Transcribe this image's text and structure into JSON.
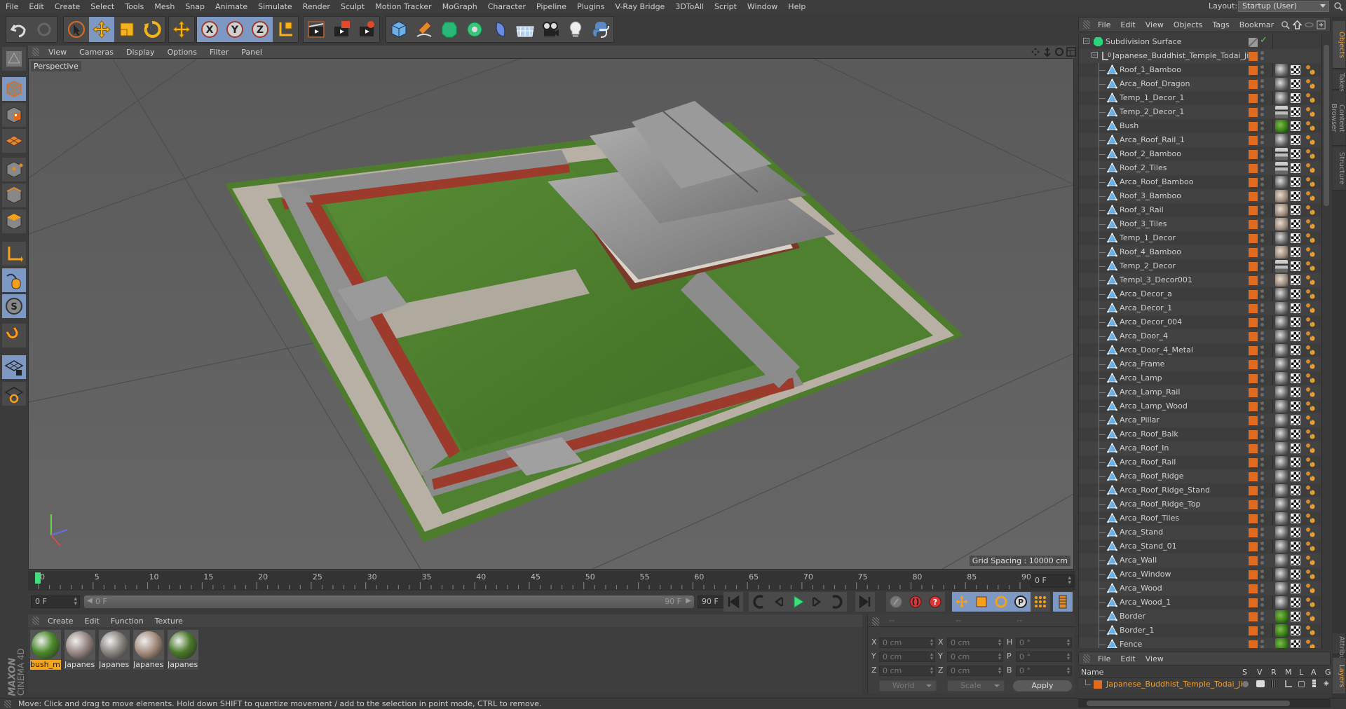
{
  "menubar": {
    "items": [
      "File",
      "Edit",
      "Create",
      "Select",
      "Tools",
      "Mesh",
      "Snap",
      "Animate",
      "Simulate",
      "Render",
      "Sculpt",
      "Motion Tracker",
      "MoGraph",
      "Character",
      "Pipeline",
      "Plugins",
      "V-Ray Bridge",
      "3DToAll",
      "Script",
      "Window",
      "Help"
    ],
    "layout_label": "Layout:",
    "layout_value": "Startup (User)"
  },
  "toolbar": {
    "groups": [
      [
        "undo-icon",
        "redo-icon"
      ],
      [
        "live-selection-icon",
        "move-icon",
        "scale-icon",
        "rotate-icon"
      ],
      [
        "recent-tool-icon"
      ],
      [
        "x-axis-lock-icon",
        "y-axis-lock-icon",
        "z-axis-lock-icon",
        "coordinate-system-icon"
      ],
      [
        "render-view-icon",
        "render-picture-viewer-icon",
        "edit-render-settings-icon"
      ],
      [
        "cube-icon",
        "pen-spline-icon",
        "subdivision-surface-icon",
        "cloner-icon",
        "deformer-icon",
        "floor-icon",
        "camera-icon",
        "light-icon",
        "python-icon"
      ]
    ]
  },
  "lefttools": [
    "model-mode-icon",
    "object-mode-icon",
    "texture-mode-icon",
    "workplane-icon",
    "points-mode-icon",
    "edges-mode-icon",
    "polygons-mode-icon",
    "axis-mode-icon",
    "tweak-mode-icon",
    "solo-icon",
    "snap-magnet-icon",
    "lock-workplane-icon",
    "workplane-planar-icon"
  ],
  "viewport": {
    "menu": [
      "View",
      "Cameras",
      "Display",
      "Options",
      "Filter",
      "Panel"
    ],
    "camera_label": "Perspective",
    "grid_spacing": "Grid Spacing : 10000 cm",
    "colors": {
      "background": "#5c5c5c",
      "grass": "#4d7d2c",
      "roof": "#8a8a8a",
      "wall": "#9c3a2c",
      "path": "#b5aca0"
    }
  },
  "timeline": {
    "start": 0,
    "end": 90,
    "major_step": 5,
    "labels": [
      "0",
      "5",
      "10",
      "15",
      "20",
      "25",
      "30",
      "35",
      "40",
      "45",
      "50",
      "55",
      "60",
      "65",
      "70",
      "75",
      "80",
      "85",
      "90"
    ],
    "current_frame_field": "0 F",
    "range_start_field": "0 F",
    "range_slider_start": "0 F",
    "range_slider_end": "90 F",
    "range_end_field": "90 F",
    "current_frame": 0
  },
  "transport": [
    "go-to-start-icon",
    "previous-keyframe-icon",
    "previous-frame-icon",
    "play-icon",
    "next-frame-icon",
    "next-keyframe-icon",
    "go-to-end-icon",
    "motion-path-icon",
    "record-keyframe-icon",
    "autokey-icon",
    "key-position-icon",
    "key-scale-icon",
    "key-rotation-icon",
    "key-parameter-icon",
    "key-pla-icon",
    "timeline-icon"
  ],
  "materials": {
    "menu": [
      "Create",
      "Edit",
      "Function",
      "Texture"
    ],
    "items": [
      {
        "label": "bush_m",
        "selected": true,
        "color": "#4a8a2a"
      },
      {
        "label": "Japanes",
        "selected": false,
        "color": "#9a8a86"
      },
      {
        "label": "Japanes",
        "selected": false,
        "color": "#8a8680"
      },
      {
        "label": "Japanes",
        "selected": false,
        "color": "#a89080"
      },
      {
        "label": "Japanes",
        "selected": false,
        "color": "#4a7a2a"
      }
    ]
  },
  "coordinates": {
    "header": [
      "--",
      "--",
      "--"
    ],
    "position": {
      "X": "0 cm",
      "Y": "0 cm",
      "Z": "0 cm"
    },
    "size": {
      "X": "0 cm",
      "Y": "0 cm",
      "Z": "0 cm"
    },
    "rotation": {
      "H": "0 °",
      "P": "0 °",
      "B": "0 °"
    },
    "space_dropdown": "World",
    "mode_dropdown": "Scale",
    "apply_label": "Apply"
  },
  "status": "Move: Click and drag to move elements. Hold down SHIFT to quantize movement / add to the selection in point mode, CTRL to remove.",
  "brand": {
    "line1": "MAXON",
    "line2": "CINEMA 4D"
  },
  "objects": {
    "menu": [
      "File",
      "Edit",
      "View",
      "Objects",
      "Tags",
      "Bookmar"
    ],
    "root": "Subdivision Surface",
    "group": "Japanese_Buddhist_Temple_Todai_Ji",
    "children": [
      {
        "name": "Roof_1_Bamboo",
        "mat": "stone"
      },
      {
        "name": "Arca_Roof_Dragon",
        "mat": "stone"
      },
      {
        "name": "Temp_1_Decor_1",
        "mat": "stone"
      },
      {
        "name": "Temp_2_Decor_1",
        "mat": "stripe"
      },
      {
        "name": "Bush",
        "mat": "green"
      },
      {
        "name": "Arca_Roof_Rail_1",
        "mat": "stone"
      },
      {
        "name": "Roof_2_Bamboo",
        "mat": "stripe"
      },
      {
        "name": "Roof_2_Tiles",
        "mat": "stripe"
      },
      {
        "name": "Arca_Roof_Bamboo",
        "mat": "stone"
      },
      {
        "name": "Roof_3_Bamboo",
        "mat": "warm"
      },
      {
        "name": "Roof_3_Rail",
        "mat": "warm"
      },
      {
        "name": "Roof_3_Tiles",
        "mat": "warm"
      },
      {
        "name": "Temp_1_Decor",
        "mat": "stone"
      },
      {
        "name": "Roof_4_Bamboo",
        "mat": "warm"
      },
      {
        "name": "Temp_2_Decor",
        "mat": "stripe"
      },
      {
        "name": "Templ_3_Decor001",
        "mat": "warm"
      },
      {
        "name": "Arca_Decor_a",
        "mat": "stone"
      },
      {
        "name": "Arca_Decor_1",
        "mat": "stone"
      },
      {
        "name": "Arca_Decor_004",
        "mat": "stone"
      },
      {
        "name": "Arca_Door_4",
        "mat": "stone"
      },
      {
        "name": "Arca_Door_4_Metal",
        "mat": "stone"
      },
      {
        "name": "Arca_Frame",
        "mat": "stone"
      },
      {
        "name": "Arca_Lamp",
        "mat": "stone"
      },
      {
        "name": "Arca_Lamp_Rail",
        "mat": "stone"
      },
      {
        "name": "Arca_Lamp_Wood",
        "mat": "stone"
      },
      {
        "name": "Arca_Pillar",
        "mat": "stone"
      },
      {
        "name": "Arca_Roof_Balk",
        "mat": "stone"
      },
      {
        "name": "Arca_Roof_In",
        "mat": "stone"
      },
      {
        "name": "Arca_Roof_Rail",
        "mat": "stone"
      },
      {
        "name": "Arca_Roof_Ridge",
        "mat": "stone"
      },
      {
        "name": "Arca_Roof_Ridge_Stand",
        "mat": "stone"
      },
      {
        "name": "Arca_Roof_Ridge_Top",
        "mat": "stone"
      },
      {
        "name": "Arca_Roof_Tiles",
        "mat": "stone"
      },
      {
        "name": "Arca_Stand",
        "mat": "stone"
      },
      {
        "name": "Arca_Stand_01",
        "mat": "stone"
      },
      {
        "name": "Arca_Wall",
        "mat": "stone"
      },
      {
        "name": "Arca_Window",
        "mat": "stone"
      },
      {
        "name": "Arca_Wood",
        "mat": "stone"
      },
      {
        "name": "Arca_Wood_1",
        "mat": "stone"
      },
      {
        "name": "Border",
        "mat": "green"
      },
      {
        "name": "Border_1",
        "mat": "green"
      },
      {
        "name": "Fence",
        "mat": "green"
      }
    ],
    "layer_color": "#e06b1f"
  },
  "layers": {
    "menu": [
      "File",
      "Edit",
      "View"
    ],
    "columns": [
      "Name",
      "S",
      "V",
      "R",
      "M",
      "L",
      "A",
      "G"
    ],
    "rows": [
      {
        "name": "Japanese_Buddhist_Temple_Todai_Ji",
        "color": "#e06b1f"
      }
    ]
  },
  "side_tabs": [
    {
      "label": "Objects",
      "active": true
    },
    {
      "label": "Takes",
      "active": false
    },
    {
      "label": "Content Browser",
      "active": false
    },
    {
      "label": "Structure",
      "active": false
    }
  ],
  "side_tabs_bottom": [
    {
      "label": "Attributes",
      "active": false
    },
    {
      "label": "Layers",
      "active": true
    }
  ]
}
